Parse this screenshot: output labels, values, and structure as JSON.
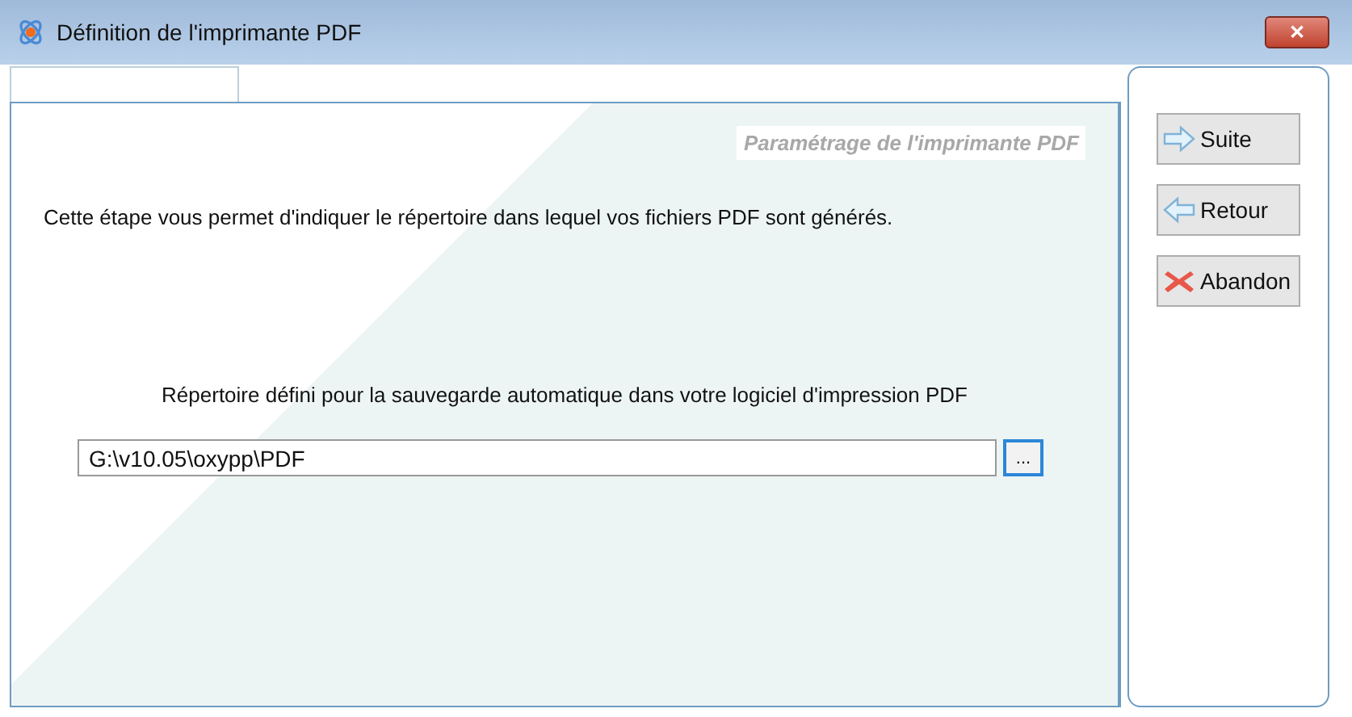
{
  "window": {
    "title": "Définition de l'imprimante PDF",
    "close": "✕"
  },
  "tabs": [
    {
      "selected": true
    }
  ],
  "panel": {
    "heading": "Paramétrage de l'imprimante PDF",
    "intro": "Cette étape vous permet d'indiquer le répertoire dans lequel vos fichiers PDF sont générés.",
    "field_label": "Répertoire défini pour la sauvegarde automatique dans votre logiciel d'impression PDF",
    "field_value": "G:\\v10.05\\oxypp\\PDF",
    "browse": "..."
  },
  "buttons": [
    {
      "label": "Suite",
      "kind": "next"
    },
    {
      "label": "Retour",
      "kind": "back"
    },
    {
      "label": "Abandon",
      "kind": "cancel"
    }
  ]
}
